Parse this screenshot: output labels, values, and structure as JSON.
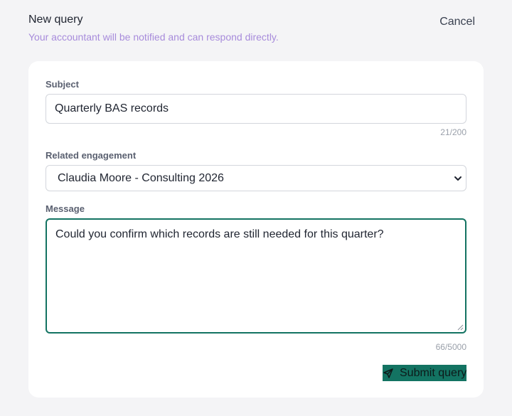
{
  "header": {
    "title": "New query",
    "subtitle": "Your accountant will be notified and can respond directly.",
    "cancel_label": "Cancel"
  },
  "form": {
    "subject": {
      "label": "Subject",
      "value": "Quarterly BAS records",
      "counter": "21/200"
    },
    "engagement": {
      "label": "Related engagement",
      "selected": "Claudia Moore - Consulting 2026"
    },
    "message": {
      "label": "Message",
      "value": "Could you confirm which records are still needed for this quarter?",
      "counter": "66/5000"
    },
    "submit_label": "Submit query"
  },
  "icons": {
    "send": "send-icon",
    "chevron": "chevron-down-icon",
    "resize": "resize-handle-icon"
  },
  "colors": {
    "accent": "#137362",
    "subtitle": "#a78bdb",
    "background": "#f4f4f6"
  }
}
